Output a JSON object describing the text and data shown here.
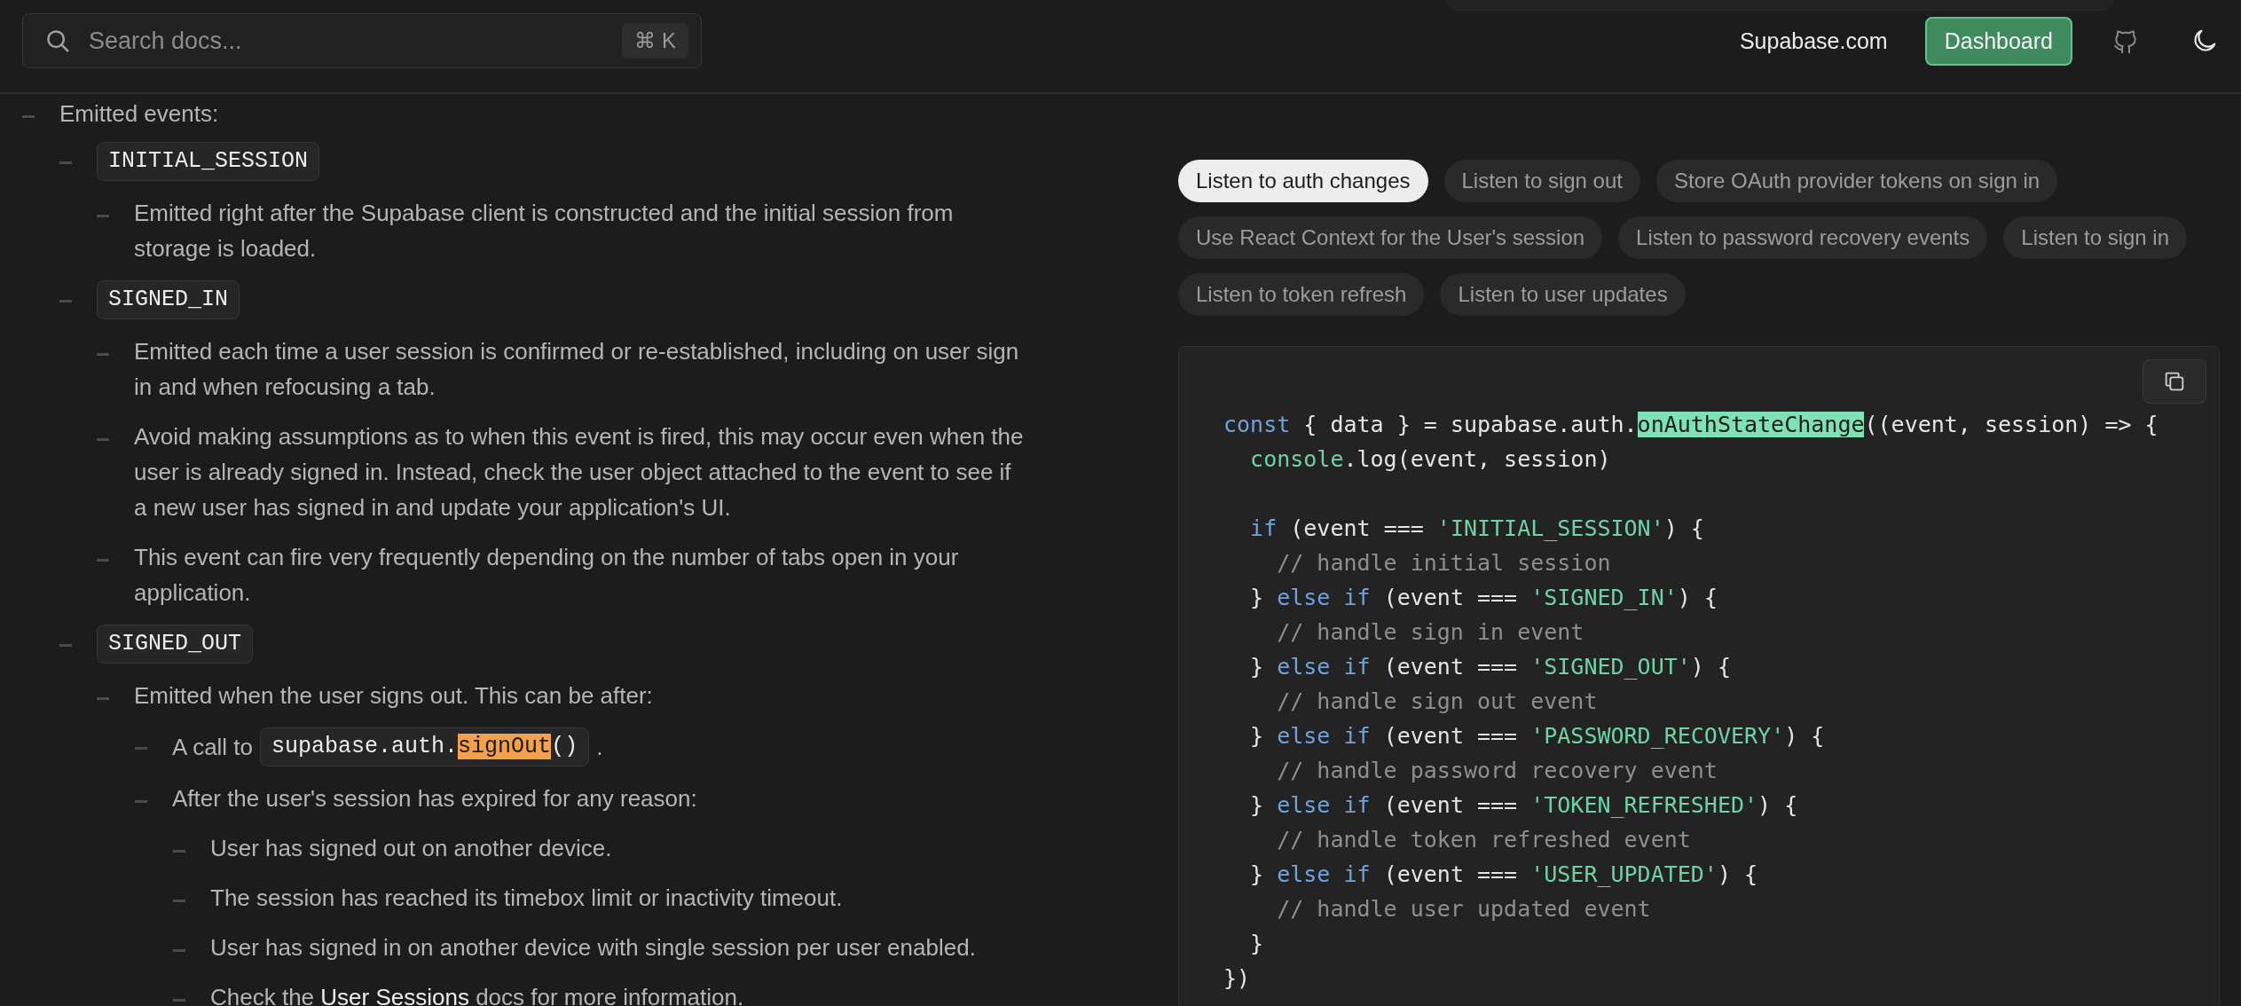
{
  "header": {
    "search": {
      "placeholder": "Search docs...",
      "shortcut": "⌘ K"
    },
    "links": [
      {
        "label": "Supabase.com",
        "kind": "link"
      },
      {
        "label": "Dashboard",
        "kind": "primary"
      }
    ]
  },
  "outline": [
    {
      "parts": [
        {
          "kind": "text",
          "text": "Emitted events:"
        }
      ],
      "children": [
        {
          "parts": [
            {
              "kind": "code",
              "segments": [
                {
                  "text": "INITIAL_SESSION",
                  "highlighted": false
                }
              ]
            }
          ],
          "children": [
            {
              "parts": [
                {
                  "kind": "text",
                  "text": "Emitted right after the Supabase client is constructed and the initial session from storage is loaded."
                }
              ]
            }
          ]
        },
        {
          "parts": [
            {
              "kind": "code",
              "segments": [
                {
                  "text": "SIGNED_IN",
                  "highlighted": false
                }
              ]
            }
          ],
          "children": [
            {
              "parts": [
                {
                  "kind": "text",
                  "text": "Emitted each time a user session is confirmed or re-established, including on user sign in and when refocusing a tab."
                }
              ]
            },
            {
              "parts": [
                {
                  "kind": "text",
                  "text": "Avoid making assumptions as to when this event is fired, this may occur even when the user is already signed in. Instead, check the user object attached to the event to see if a new user has signed in and update your application's UI."
                }
              ]
            },
            {
              "parts": [
                {
                  "kind": "text",
                  "text": "This event can fire very frequently depending on the number of tabs open in your application."
                }
              ]
            }
          ]
        },
        {
          "parts": [
            {
              "kind": "code",
              "segments": [
                {
                  "text": "SIGNED_OUT",
                  "highlighted": false
                }
              ]
            }
          ],
          "children": [
            {
              "parts": [
                {
                  "kind": "text",
                  "text": "Emitted when the user signs out. This can be after:"
                }
              ],
              "children": [
                {
                  "parts": [
                    {
                      "kind": "text",
                      "text": "A call to"
                    },
                    {
                      "kind": "code",
                      "segments": [
                        {
                          "text": "supabase.auth.",
                          "highlighted": false
                        },
                        {
                          "text": "signOut",
                          "highlighted": true
                        },
                        {
                          "text": "()",
                          "highlighted": false
                        }
                      ]
                    },
                    {
                      "kind": "text",
                      "text": "."
                    }
                  ]
                },
                {
                  "parts": [
                    {
                      "kind": "text",
                      "text": "After the user's session has expired for any reason:"
                    }
                  ],
                  "children": [
                    {
                      "parts": [
                        {
                          "kind": "text",
                          "text": "User has signed out on another device."
                        }
                      ]
                    },
                    {
                      "parts": [
                        {
                          "kind": "text",
                          "text": "The session has reached its timebox limit or inactivity timeout."
                        }
                      ]
                    },
                    {
                      "parts": [
                        {
                          "kind": "text",
                          "text": "User has signed in on another device with single session per user enabled."
                        }
                      ]
                    },
                    {
                      "parts": [
                        {
                          "kind": "text",
                          "text": "Check the "
                        },
                        {
                          "kind": "link",
                          "text": "User Sessions"
                        },
                        {
                          "kind": "text",
                          "text": " docs for more information."
                        }
                      ]
                    }
                  ]
                }
              ]
            }
          ]
        }
      ]
    }
  ],
  "examples": [
    {
      "label": "Listen to auth changes",
      "selected": true
    },
    {
      "label": "Listen to sign out",
      "selected": false
    },
    {
      "label": "Store OAuth provider tokens on sign in",
      "selected": false
    },
    {
      "label": "Use React Context for the User's session",
      "selected": false
    },
    {
      "label": "Listen to password recovery events",
      "selected": false
    },
    {
      "label": "Listen to sign in",
      "selected": false
    },
    {
      "label": "Listen to token refresh",
      "selected": false
    },
    {
      "label": "Listen to user updates",
      "selected": false
    }
  ],
  "code_lines": [
    {
      "kind": "code",
      "tokens": [
        {
          "kind": "keyword",
          "text": "const"
        },
        {
          "kind": "plain",
          "text": " { data } = supabase.auth."
        },
        {
          "kind": "match",
          "text": "onAuthStateChange"
        },
        {
          "kind": "plain",
          "text": "((event, session) => {"
        }
      ]
    },
    {
      "kind": "code",
      "tokens": [
        {
          "kind": "function",
          "text": "  console"
        },
        {
          "kind": "plain",
          "text": ".log(event, session)"
        }
      ]
    },
    {
      "kind": "blank"
    },
    {
      "kind": "code",
      "tokens": [
        {
          "kind": "keyword",
          "text": "  if"
        },
        {
          "kind": "plain",
          "text": " (event === "
        },
        {
          "kind": "string",
          "text": "'INITIAL_SESSION'"
        },
        {
          "kind": "plain",
          "text": ") {"
        }
      ]
    },
    {
      "kind": "code",
      "tokens": [
        {
          "kind": "comment",
          "text": "    // handle initial session"
        }
      ]
    },
    {
      "kind": "code",
      "tokens": [
        {
          "kind": "plain",
          "text": "  } "
        },
        {
          "kind": "keyword",
          "text": "else if"
        },
        {
          "kind": "plain",
          "text": " (event === "
        },
        {
          "kind": "string",
          "text": "'SIGNED_IN'"
        },
        {
          "kind": "plain",
          "text": ") {"
        }
      ]
    },
    {
      "kind": "code",
      "tokens": [
        {
          "kind": "comment",
          "text": "    // handle sign in event"
        }
      ]
    },
    {
      "kind": "code",
      "tokens": [
        {
          "kind": "plain",
          "text": "  } "
        },
        {
          "kind": "keyword",
          "text": "else if"
        },
        {
          "kind": "plain",
          "text": " (event === "
        },
        {
          "kind": "string",
          "text": "'SIGNED_OUT'"
        },
        {
          "kind": "plain",
          "text": ") {"
        }
      ]
    },
    {
      "kind": "code",
      "tokens": [
        {
          "kind": "comment",
          "text": "    // handle sign out event"
        }
      ]
    },
    {
      "kind": "code",
      "tokens": [
        {
          "kind": "plain",
          "text": "  } "
        },
        {
          "kind": "keyword",
          "text": "else if"
        },
        {
          "kind": "plain",
          "text": " (event === "
        },
        {
          "kind": "string",
          "text": "'PASSWORD_RECOVERY'"
        },
        {
          "kind": "plain",
          "text": ") {"
        }
      ]
    },
    {
      "kind": "code",
      "tokens": [
        {
          "kind": "comment",
          "text": "    // handle password recovery event"
        }
      ]
    },
    {
      "kind": "code",
      "tokens": [
        {
          "kind": "plain",
          "text": "  } "
        },
        {
          "kind": "keyword",
          "text": "else if"
        },
        {
          "kind": "plain",
          "text": " (event === "
        },
        {
          "kind": "string",
          "text": "'TOKEN_REFRESHED'"
        },
        {
          "kind": "plain",
          "text": ") {"
        }
      ]
    },
    {
      "kind": "code",
      "tokens": [
        {
          "kind": "comment",
          "text": "    // handle token refreshed event"
        }
      ]
    },
    {
      "kind": "code",
      "tokens": [
        {
          "kind": "plain",
          "text": "  } "
        },
        {
          "kind": "keyword",
          "text": "else if"
        },
        {
          "kind": "plain",
          "text": " (event === "
        },
        {
          "kind": "string",
          "text": "'USER_UPDATED'"
        },
        {
          "kind": "plain",
          "text": ") {"
        }
      ]
    },
    {
      "kind": "code",
      "tokens": [
        {
          "kind": "comment",
          "text": "    // handle user updated event"
        }
      ]
    },
    {
      "kind": "code",
      "tokens": [
        {
          "kind": "plain",
          "text": "  }"
        }
      ]
    },
    {
      "kind": "code",
      "tokens": [
        {
          "kind": "plain",
          "text": "})"
        }
      ]
    }
  ]
}
